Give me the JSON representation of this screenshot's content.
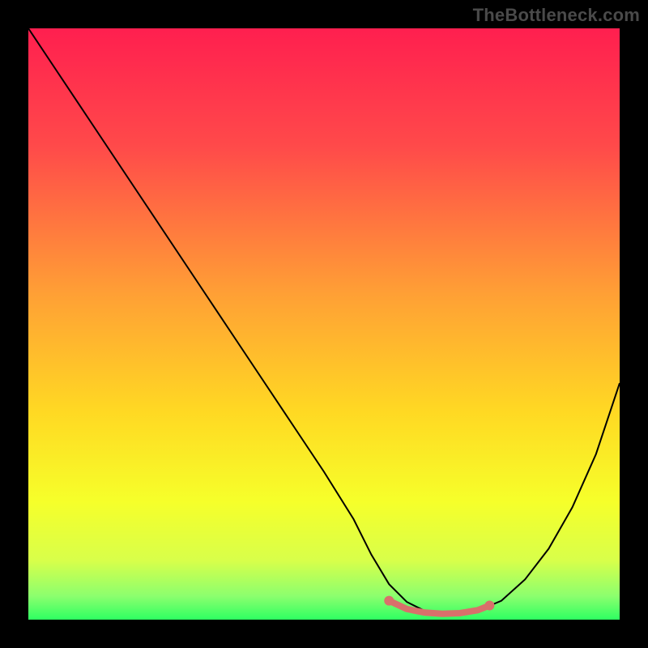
{
  "watermark": "TheBottleneck.com",
  "chart_data": {
    "type": "line",
    "title": "",
    "xlabel": "",
    "ylabel": "",
    "xlim": [
      0,
      100
    ],
    "ylim": [
      0,
      100
    ],
    "grid": false,
    "background_gradient": {
      "orientation": "vertical",
      "stops": [
        {
          "offset": 0.0,
          "color": "#ff1f4f"
        },
        {
          "offset": 0.2,
          "color": "#ff4a4a"
        },
        {
          "offset": 0.45,
          "color": "#ffa035"
        },
        {
          "offset": 0.65,
          "color": "#ffd923"
        },
        {
          "offset": 0.8,
          "color": "#f6ff2a"
        },
        {
          "offset": 0.9,
          "color": "#d8ff4a"
        },
        {
          "offset": 0.96,
          "color": "#8cff6e"
        },
        {
          "offset": 1.0,
          "color": "#2eff62"
        }
      ]
    },
    "series": [
      {
        "name": "bottleneck-curve",
        "color": "#000000",
        "width": 2,
        "x": [
          0.0,
          5,
          10,
          15,
          20,
          25,
          30,
          35,
          40,
          45,
          50,
          55,
          58,
          61,
          64,
          67,
          70,
          73,
          76,
          80,
          84,
          88,
          92,
          96,
          100
        ],
        "y": [
          100,
          92.5,
          85,
          77.5,
          70,
          62.5,
          55,
          47.5,
          40,
          32.5,
          25,
          17,
          11,
          6,
          3,
          1.5,
          1,
          1,
          1.5,
          3.2,
          6.8,
          12,
          19,
          28,
          40
        ]
      }
    ],
    "highlight_segment": {
      "name": "flat-bottom",
      "color": "#d9706b",
      "width": 8,
      "x": [
        61,
        64,
        67,
        70,
        73,
        76,
        78
      ],
      "y": [
        3.2,
        1.8,
        1.2,
        1.0,
        1.1,
        1.6,
        2.4
      ],
      "endpoints": true
    }
  }
}
